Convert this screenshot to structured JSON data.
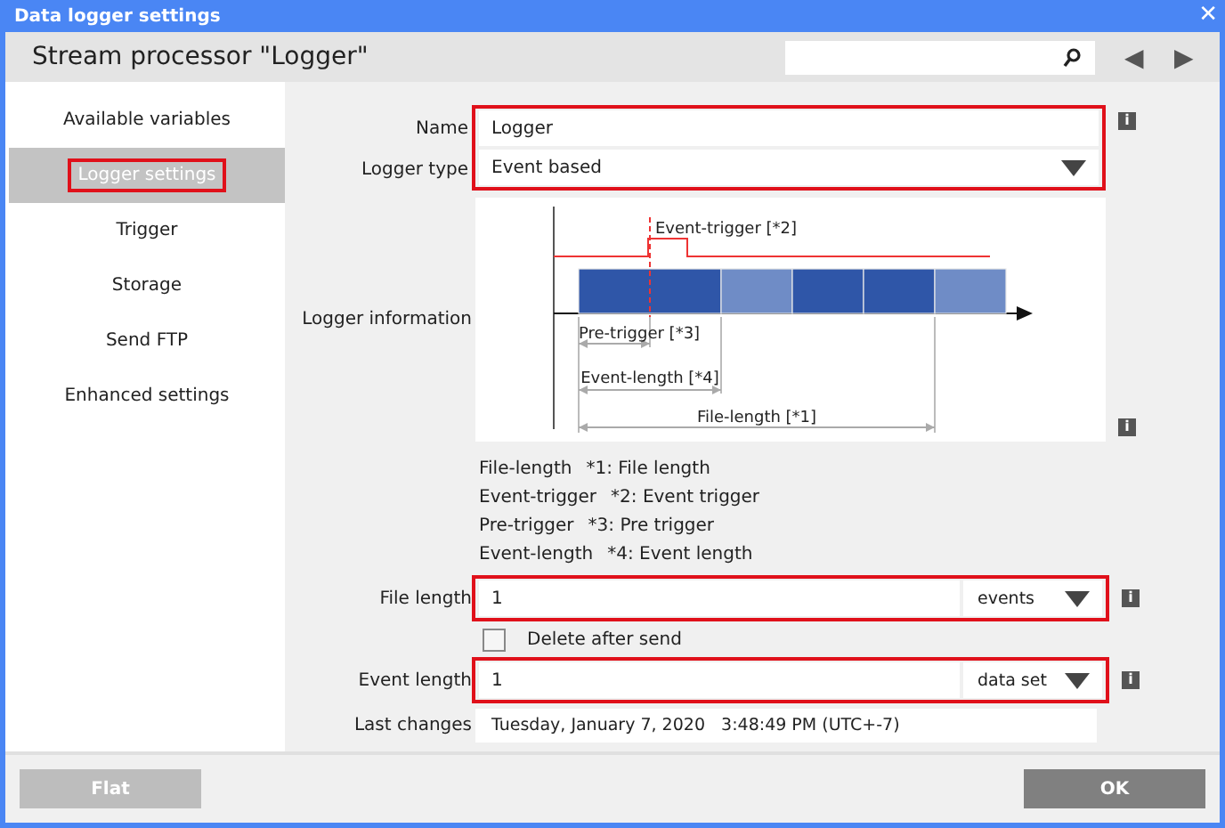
{
  "window": {
    "title": "Data logger settings",
    "close": "✕"
  },
  "header": {
    "title": "Stream processor \"Logger\"",
    "back": "◀",
    "forward": "▶"
  },
  "sidebar": {
    "items": [
      {
        "label": "Available variables",
        "selected": false,
        "highlighted": false
      },
      {
        "label": "Logger settings",
        "selected": true,
        "highlighted": true
      },
      {
        "label": "Trigger",
        "selected": false,
        "highlighted": false
      },
      {
        "label": "Storage",
        "selected": false,
        "highlighted": false
      },
      {
        "label": "Send FTP",
        "selected": false,
        "highlighted": false
      },
      {
        "label": "Enhanced settings",
        "selected": false,
        "highlighted": false
      }
    ]
  },
  "form": {
    "name": {
      "label": "Name",
      "value": "Logger",
      "info": "i"
    },
    "logger_type": {
      "label": "Logger type",
      "value": "Event based"
    },
    "top_group_highlighted": true,
    "logger_information": {
      "label": "Logger information",
      "event_trigger": "Event-trigger [*2]",
      "pre_trigger": "Pre-trigger [*3]",
      "event_length": "Event-length [*4]",
      "file_length": "File-length [*1]",
      "info": "i"
    },
    "legend": [
      {
        "term": "File-length",
        "meaning": "*1: File length"
      },
      {
        "term": "Event-trigger",
        "meaning": "*2: Event trigger"
      },
      {
        "term": "Pre-trigger",
        "meaning": "*3: Pre trigger"
      },
      {
        "term": "Event-length",
        "meaning": "*4: Event length"
      }
    ],
    "file_length": {
      "label": "File length",
      "value": "1",
      "unit": "events",
      "highlighted": true,
      "info": "i"
    },
    "delete_after_send": {
      "label": "Delete after send",
      "checked": false
    },
    "event_length": {
      "label": "Event length",
      "value": "1",
      "unit": "data set",
      "highlighted": true,
      "info": "i"
    },
    "last_changes": {
      "label": "Last changes",
      "value": "Tuesday, January 7, 2020   3:48:49 PM (UTC+-7)"
    }
  },
  "footer": {
    "buttons": [
      {
        "label": "Flat",
        "kind": "secondary"
      },
      {
        "label": "OK",
        "kind": "primary"
      }
    ]
  }
}
